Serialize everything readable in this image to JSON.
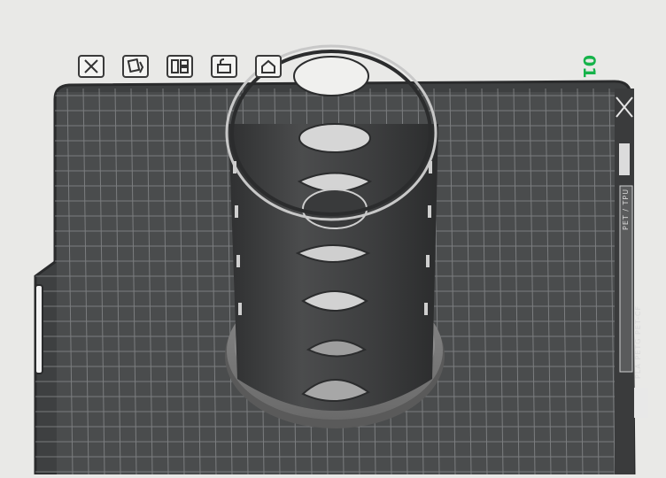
{
  "plate": {
    "label": "01",
    "label_color": "#16b34a",
    "surface_color": "#4a4c4d",
    "grid_color": "#8c8e90",
    "side_text_upper": "PET / TPU",
    "side_text_lower": "PLA PETG PET-CF"
  },
  "toolbar": {
    "items": [
      {
        "name": "close-icon"
      },
      {
        "name": "auto-orient-icon"
      },
      {
        "name": "arrange-icon"
      },
      {
        "name": "lock-icon"
      },
      {
        "name": "plate-settings-icon"
      }
    ]
  },
  "model": {
    "name": "cylindrical-holder",
    "body_color": "#454647",
    "base_color": "#7a7a7a"
  }
}
